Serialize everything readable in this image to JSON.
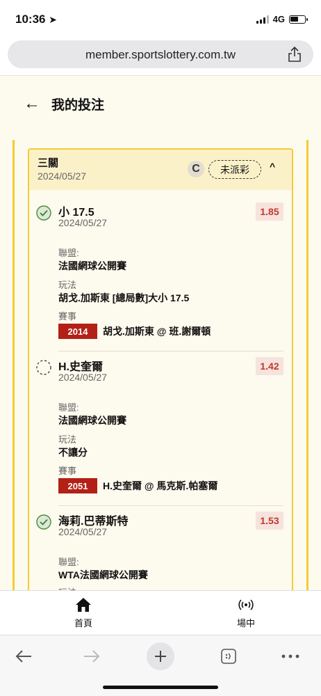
{
  "status_bar": {
    "time": "10:36",
    "network": "4G"
  },
  "browser": {
    "url": "member.sportslottery.com.tw"
  },
  "page": {
    "back_label": "←",
    "title": "我的投注"
  },
  "ticket": {
    "kind": "三關",
    "date": "2024/05/27",
    "refresh_icon": "C",
    "status": "未派彩",
    "collapse_icon": "^"
  },
  "labels": {
    "league": "聯盟:",
    "market": "玩法",
    "event": "賽事"
  },
  "bets": [
    {
      "selection": "小 17.5",
      "date": "2024/05/27",
      "odds": "1.85",
      "league": "法國網球公開賽",
      "market": "胡戈.加斯東 [總局數]大小 17.5",
      "code": "2014",
      "match": "胡戈.加斯東 @ 班.謝爾頓",
      "status_icon": "check-circle-icon"
    },
    {
      "selection": "H.史奎爾",
      "date": "2024/05/27",
      "odds": "1.42",
      "league": "法國網球公開賽",
      "market": "不讓分",
      "code": "2051",
      "match": "H.史奎爾 @ 馬克斯.帕塞爾",
      "status_icon": "pending-circle-icon"
    },
    {
      "selection": "海莉.巴蒂斯特",
      "date": "2024/05/27",
      "odds": "1.53",
      "league": "WTA法國網球公開賽",
      "market_label_partial": "玩法",
      "status_icon": "check-circle-icon"
    }
  ],
  "tabs": [
    {
      "label": "首頁",
      "icon": "home-icon"
    },
    {
      "label": "場中",
      "icon": "live-signal-icon"
    }
  ],
  "colors": {
    "accent": "#f3cc33",
    "odds_red": "#c0392b",
    "code_red": "#b32016",
    "page_bg": "#fdfaee"
  }
}
